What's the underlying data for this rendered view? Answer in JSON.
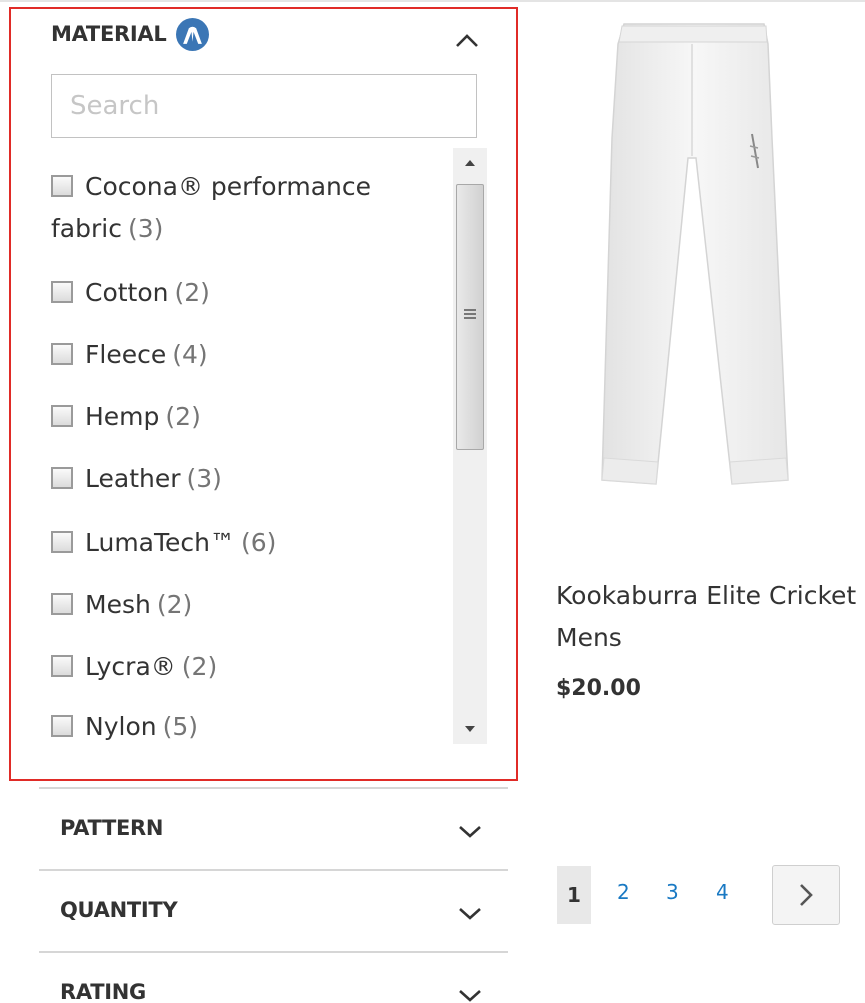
{
  "filters": {
    "material": {
      "title": "MATERIAL",
      "brand_icon": "brand-logo-icon",
      "toggle_icon": "chevron-up-icon",
      "search_placeholder": "Search",
      "search_value": "",
      "options": [
        {
          "line1": "Cocona® performance",
          "line2": "fabric",
          "count": "(3)",
          "checked": false
        },
        {
          "label": "Cotton",
          "count": "(2)",
          "checked": false
        },
        {
          "label": "Fleece",
          "count": "(4)",
          "checked": false
        },
        {
          "label": "Hemp",
          "count": "(2)",
          "checked": false
        },
        {
          "label": "Leather",
          "count": "(3)",
          "checked": false
        },
        {
          "label": "LumaTech™",
          "count": "(6)",
          "checked": false
        },
        {
          "label": "Mesh",
          "count": "(2)",
          "checked": false
        },
        {
          "label": "Lycra®",
          "count": "(2)",
          "checked": false
        },
        {
          "label": "Nylon",
          "count": "(5)",
          "checked": false
        }
      ]
    },
    "collapsed": [
      {
        "title": "PATTERN",
        "toggle_icon": "chevron-down-icon"
      },
      {
        "title": "QUANTITY",
        "toggle_icon": "chevron-down-icon"
      },
      {
        "title": "RATING",
        "toggle_icon": "chevron-down-icon"
      }
    ]
  },
  "product": {
    "name_line1": "Kookaburra Elite Cricket",
    "name_line2": "Mens",
    "price": "$20.00",
    "image": "white-cricket-pants-image"
  },
  "pagination": {
    "current": "1",
    "pages": [
      "2",
      "3",
      "4"
    ],
    "next_icon": "chevron-right-icon"
  },
  "colors": {
    "highlight_border": "#e02b27",
    "link": "#1979c3",
    "brand_icon_bg": "#3b76b5",
    "count_text": "#757575"
  }
}
